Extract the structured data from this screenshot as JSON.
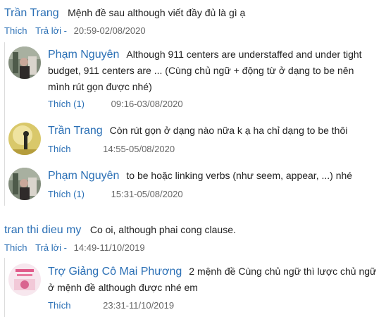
{
  "comments": [
    {
      "name": "Trần Trang",
      "text": "Mệnh đề sau although viết đầy đủ là gì ạ",
      "like": "Thích",
      "reply": "Trả lời -",
      "time": "20:59-02/08/2020",
      "replies": [
        {
          "name": "Phạm Nguyên",
          "text": "Although 911 centers are understaffed and under tight budget, 911 centers are ... (Cùng chủ ngữ + động từ ở dạng to be nên mình rút gọn được nhé)",
          "like": "Thích (1)",
          "time": "09:16-03/08/2020"
        },
        {
          "name": "Trần Trang",
          "text": "Còn rút gọn ở dạng nào nữa k ạ ha chỉ dạng to be thôi",
          "like": "Thích",
          "time": "14:55-05/08/2020"
        },
        {
          "name": "Phạm Nguyên",
          "text": "to be hoặc linking verbs (như seem, appear, ...) nhé",
          "like": "Thích (1)",
          "time": "15:31-05/08/2020"
        }
      ]
    },
    {
      "name": "tran thi dieu my",
      "text": "Co oi, although phai cong clause.",
      "like": "Thích",
      "reply": "Trả lời -",
      "time": "14:49-11/10/2019",
      "replies": [
        {
          "name": "Trợ Giảng Cô Mai Phương",
          "text": "2 mệnh đề Cùng chủ ngữ thì lược chủ ngữ ở mệnh đề although được nhé em",
          "like": "Thích",
          "time": "23:31-11/10/2019"
        }
      ]
    }
  ]
}
